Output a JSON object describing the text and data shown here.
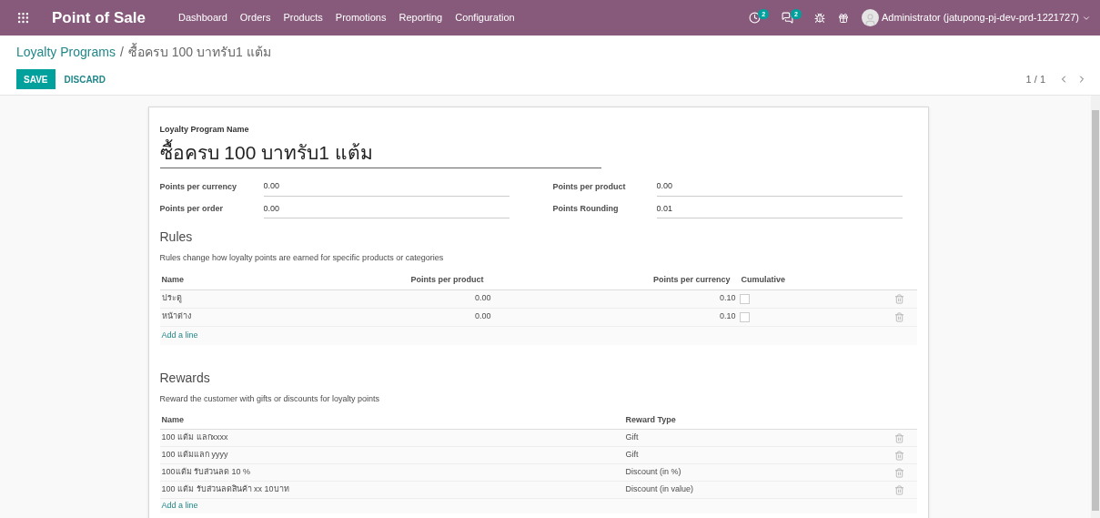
{
  "navbar": {
    "app_title": "Point of Sale",
    "menu": [
      "Dashboard",
      "Orders",
      "Products",
      "Promotions",
      "Reporting",
      "Configuration"
    ],
    "activity_badge": "2",
    "messages_badge": "2",
    "user": "Administrator (jatupong-pj-dev-prd-1221727)"
  },
  "breadcrumb": {
    "parent": "Loyalty Programs",
    "separator": "/",
    "current": "ซื้อครบ 100 บาทรับ1 แต้ม"
  },
  "buttons": {
    "save": "SAVE",
    "discard": "DISCARD"
  },
  "pager": "1 / 1",
  "form": {
    "name_label": "Loyalty Program Name",
    "name_value": "ซื้อครบ 100 บาทรับ1 แต้ม",
    "fields": [
      {
        "label": "Points per currency",
        "value": "0.00"
      },
      {
        "label": "Points per product",
        "value": "0.00"
      },
      {
        "label": "Points per order",
        "value": "0.00"
      },
      {
        "label": "Points Rounding",
        "value": "0.01"
      }
    ]
  },
  "rules": {
    "title": "Rules",
    "description": "Rules change how loyalty points are earned for specific products or categories",
    "columns": [
      "Name",
      "Points per product",
      "Points per currency",
      "Cumulative"
    ],
    "rows": [
      {
        "name": "ประตู",
        "points_per_product": "0.00",
        "points_per_currency": "0.10",
        "cumulative": false
      },
      {
        "name": "หน้าต่าง",
        "points_per_product": "0.00",
        "points_per_currency": "0.10",
        "cumulative": false
      }
    ],
    "add_line": "Add a line"
  },
  "rewards": {
    "title": "Rewards",
    "description": "Reward the customer with gifts or discounts for loyalty points",
    "columns": [
      "Name",
      "Reward Type"
    ],
    "rows": [
      {
        "name": "100 แต้ม แลกxxxx",
        "reward_type": "Gift"
      },
      {
        "name": "100 แต้มแลก yyyy",
        "reward_type": "Gift"
      },
      {
        "name": "100แต้ม รับส่วนลด 10 %",
        "reward_type": "Discount (in %)"
      },
      {
        "name": "100 แต้ม รับส่วนลดสินค้า xx 10บาท",
        "reward_type": "Discount (in value)"
      }
    ],
    "add_line": "Add a line"
  }
}
